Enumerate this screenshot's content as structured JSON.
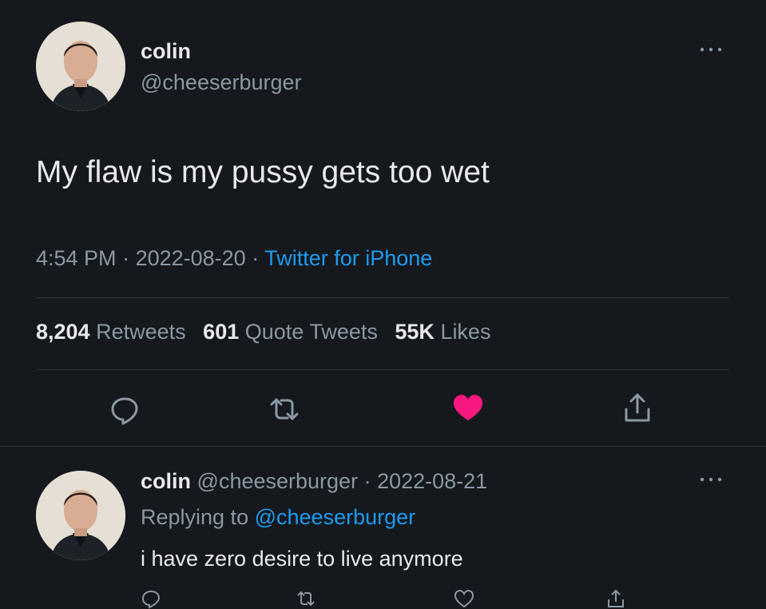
{
  "tweet": {
    "display_name": "colin",
    "handle": "@cheeserburger",
    "text": "My flaw is my pussy gets too wet",
    "time": "4:54 PM",
    "date": "2022-08-20",
    "source": "Twitter for iPhone",
    "stats": {
      "retweets_count": "8,204",
      "retweets_label": "Retweets",
      "quote_count": "601",
      "quote_label": "Quote Tweets",
      "likes_count": "55K",
      "likes_label": "Likes"
    },
    "more_icon": "more-horizontal-icon",
    "like_color": "#f91880",
    "link_color": "#1d9bf0"
  },
  "reply": {
    "display_name": "colin",
    "handle": "@cheeserburger",
    "date": "2022-08-21",
    "replying_prefix": "Replying to",
    "replying_handle": "@cheeserburger",
    "text": "i have zero desire to live anymore"
  }
}
